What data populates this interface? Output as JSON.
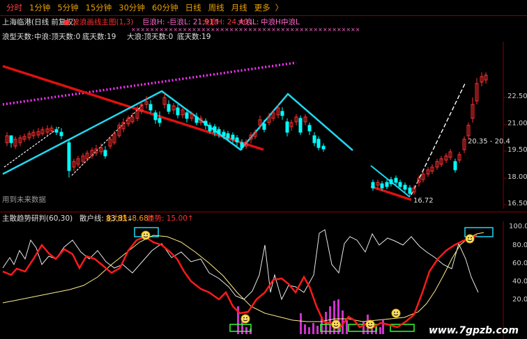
{
  "toolbar": {
    "tabs": [
      "分时",
      "1分钟",
      "5分钟",
      "15分钟",
      "30分钟",
      "60分钟",
      "日线",
      "周线",
      "月线",
      "更多"
    ],
    "active_index": 0,
    "more_arrow": "〉"
  },
  "main_panel": {
    "stock_title": "上海临港(日线 前复权)",
    "indicator_name": "波浪画线主图(1,3)",
    "h_labels": [
      {
        "text": "巨浪H: -",
        "color": "#ff66cc"
      },
      {
        "text": "巨浪L: 21.91↑",
        "color": "#ff66cc"
      },
      {
        "text": "大浪H: 24.40↓",
        "color": "#ff3030"
      },
      {
        "text": "大浪L: -",
        "color": "#ff66cc"
      },
      {
        "text": "中浪H: -",
        "color": "#ff66cc"
      },
      {
        "text": "中浪L",
        "color": "#ff66cc"
      }
    ],
    "x_row": "×××××××××××××××××××××××××××××××××××××××××××××××××",
    "stats": [
      {
        "text": "浪型天数:",
        "color": "#e0e0e0"
      },
      {
        "text": "中浪:顶天数:0",
        "color": "#e0e0e0"
      },
      {
        "text": "底天数:19",
        "color": "#e0e0e0"
      },
      {
        "text": "大浪:顶天数:0",
        "color": "#e0e0e0"
      },
      {
        "text": "底天数:19",
        "color": "#e0e0e0"
      }
    ],
    "future_label": "用到未来数据",
    "price_axis": [
      "22.50",
      "21.00",
      "19.50",
      "18.00",
      "16.50"
    ],
    "low_price_label": "16.72",
    "range_label": "20.35 - 20.4"
  },
  "sub_panel": {
    "title": "主散趋势研判(60,30)",
    "retail_label": "散户线: 83.81↓",
    "main_label": "主力线: 8.68↑",
    "trend_label": "趋势: 15.00↑",
    "axis": [
      "100.0",
      "80.0",
      "60.0",
      "40.0",
      "20.0"
    ]
  },
  "watermark": "www.7gpzb.com",
  "colors": {
    "background": "#000000",
    "up_candle": "#ff3030",
    "down_candle": "#00ffff",
    "wave_line": "#00e0ff",
    "red_trend": "#e01010",
    "magenta_dots": "#ff33ff",
    "grid": "#8a0000"
  }
}
